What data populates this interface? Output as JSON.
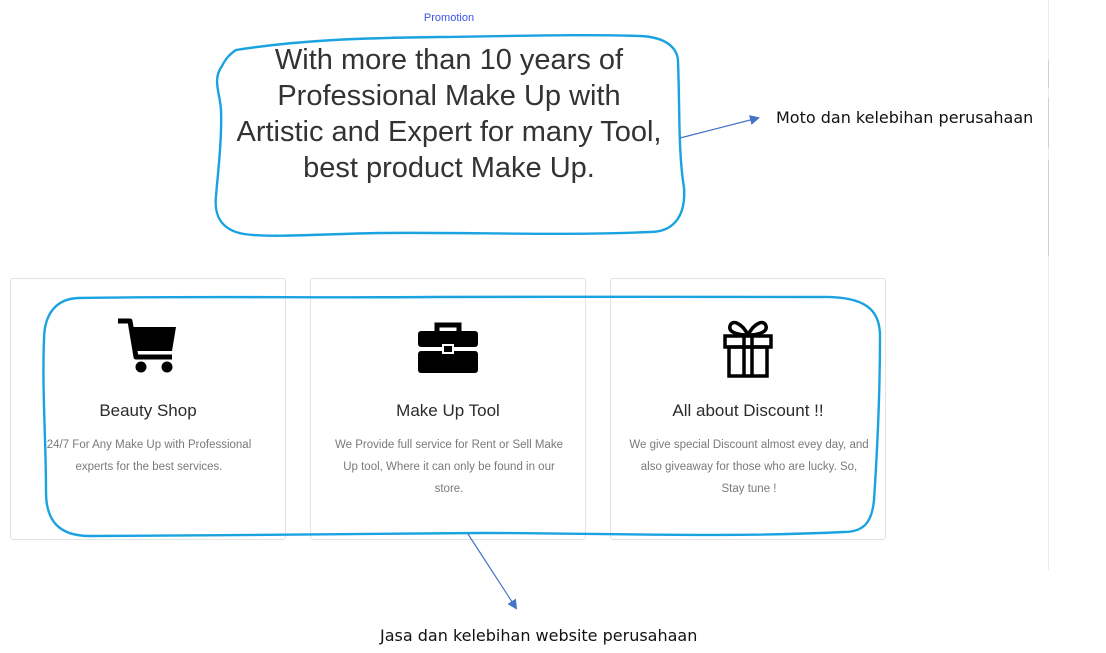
{
  "promotion": {
    "label": "Promotion",
    "headline": "With more than 10 years of Professional Make Up with Artistic and Expert for many Tool, best product Make Up."
  },
  "services": [
    {
      "icon": "shopping-cart-icon",
      "title": "Beauty Shop",
      "description": "24/7 For Any Make Up with Professional experts for the best services."
    },
    {
      "icon": "toolbox-icon",
      "title": "Make Up Tool",
      "description": "We Provide full service for Rent or Sell Make Up tool, Where it can only be found in our store."
    },
    {
      "icon": "gift-icon",
      "title": "All about Discount !!",
      "description": "We give special Discount almost evey day, and also giveaway for those who are lucky. So, Stay tune !"
    }
  ],
  "annotations": {
    "top": "Moto dan kelebihan perusahaan",
    "bottom": "Jasa dan kelebihan website perusahaan"
  },
  "colors": {
    "highlight": "#1aa3e0",
    "arrow": "#4472c4",
    "promo_label": "#3b55e6"
  }
}
